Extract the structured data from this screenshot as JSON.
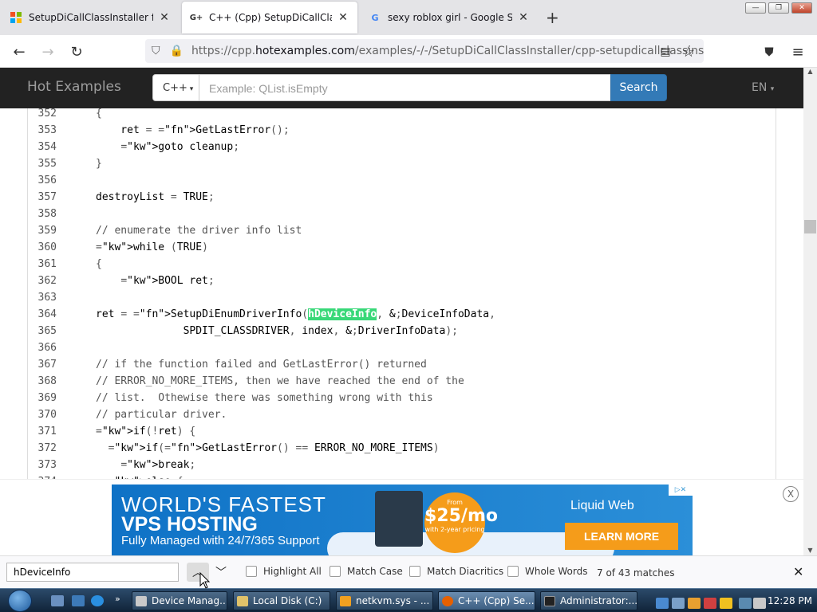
{
  "browser": {
    "tabs": [
      {
        "title": "SetupDiCallClassInstaller functio",
        "favicon": "windows-logo-icon",
        "active": false
      },
      {
        "title": "C++ (Cpp) SetupDiCallClassInst",
        "favicon": "hotexamples-icon",
        "active": true
      },
      {
        "title": "sexy roblox girl - Google Search",
        "favicon": "google-icon",
        "active": false
      }
    ],
    "new_tab": "+",
    "url_prefix": "https://cpp.",
    "url_domain": "hotexamples.com",
    "url_rest": "/examples/-/-/SetupDiCallClassInstaller/cpp-setupdicallclassinstall"
  },
  "site": {
    "brand": "Hot Examples",
    "lang_select": "C++",
    "search_placeholder": "Example: QList.isEmpty",
    "search_button": "Search",
    "locale": "EN"
  },
  "code": {
    "lines": [
      {
        "n": "352",
        "text": "{"
      },
      {
        "n": "353",
        "text": "    ret = GetLastError();"
      },
      {
        "n": "354",
        "text": "    goto cleanup;"
      },
      {
        "n": "355",
        "text": "}"
      },
      {
        "n": "356",
        "text": ""
      },
      {
        "n": "357",
        "text": "destroyList = TRUE;"
      },
      {
        "n": "358",
        "text": ""
      },
      {
        "n": "359",
        "text": "// enumerate the driver info list"
      },
      {
        "n": "360",
        "text": "while (TRUE)"
      },
      {
        "n": "361",
        "text": "{"
      },
      {
        "n": "362",
        "text": "    BOOL ret;"
      },
      {
        "n": "363",
        "text": ""
      },
      {
        "n": "364",
        "text": "ret = SetupDiEnumDriverInfo(hDeviceInfo, &DeviceInfoData,"
      },
      {
        "n": "365",
        "text": "              SPDIT_CLASSDRIVER, index, &DriverInfoData);"
      },
      {
        "n": "366",
        "text": ""
      },
      {
        "n": "367",
        "text": "// if the function failed and GetLastError() returned"
      },
      {
        "n": "368",
        "text": "// ERROR_NO_MORE_ITEMS, then we have reached the end of the"
      },
      {
        "n": "369",
        "text": "// list.  Othewise there was something wrong with this"
      },
      {
        "n": "370",
        "text": "// particular driver."
      },
      {
        "n": "371",
        "text": "if(!ret) {"
      },
      {
        "n": "372",
        "text": "  if(GetLastError() == ERROR_NO_MORE_ITEMS)"
      },
      {
        "n": "373",
        "text": "    break;"
      },
      {
        "n": "374",
        "text": "  else {"
      }
    ],
    "highlight": "hDeviceInfo"
  },
  "ad": {
    "line1": "WORLD'S FASTEST",
    "line2": "VPS HOSTING",
    "line3": "Fully Managed with 24/7/365 Support",
    "price_from": "From",
    "price": "$25/mo",
    "price_note": "with 2-year pricing",
    "brand": "Liquid Web",
    "cta": "LEARN MORE",
    "close": "X"
  },
  "findbar": {
    "query": "hDeviceInfo",
    "highlight_all": "Highlight All",
    "match_case": "Match Case",
    "match_diacritics": "Match Diacritics",
    "whole_words": "Whole Words",
    "matches": "7 of 43 matches"
  },
  "taskbar": {
    "items": [
      {
        "label": "Device Manag...",
        "active": false
      },
      {
        "label": "Local Disk (C:)",
        "active": false
      },
      {
        "label": "netkvm.sys - ...",
        "active": false
      },
      {
        "label": "C++ (Cpp) Se...",
        "active": true
      },
      {
        "label": "Administrator:...",
        "active": false
      }
    ],
    "clock": "12:28 PM"
  }
}
